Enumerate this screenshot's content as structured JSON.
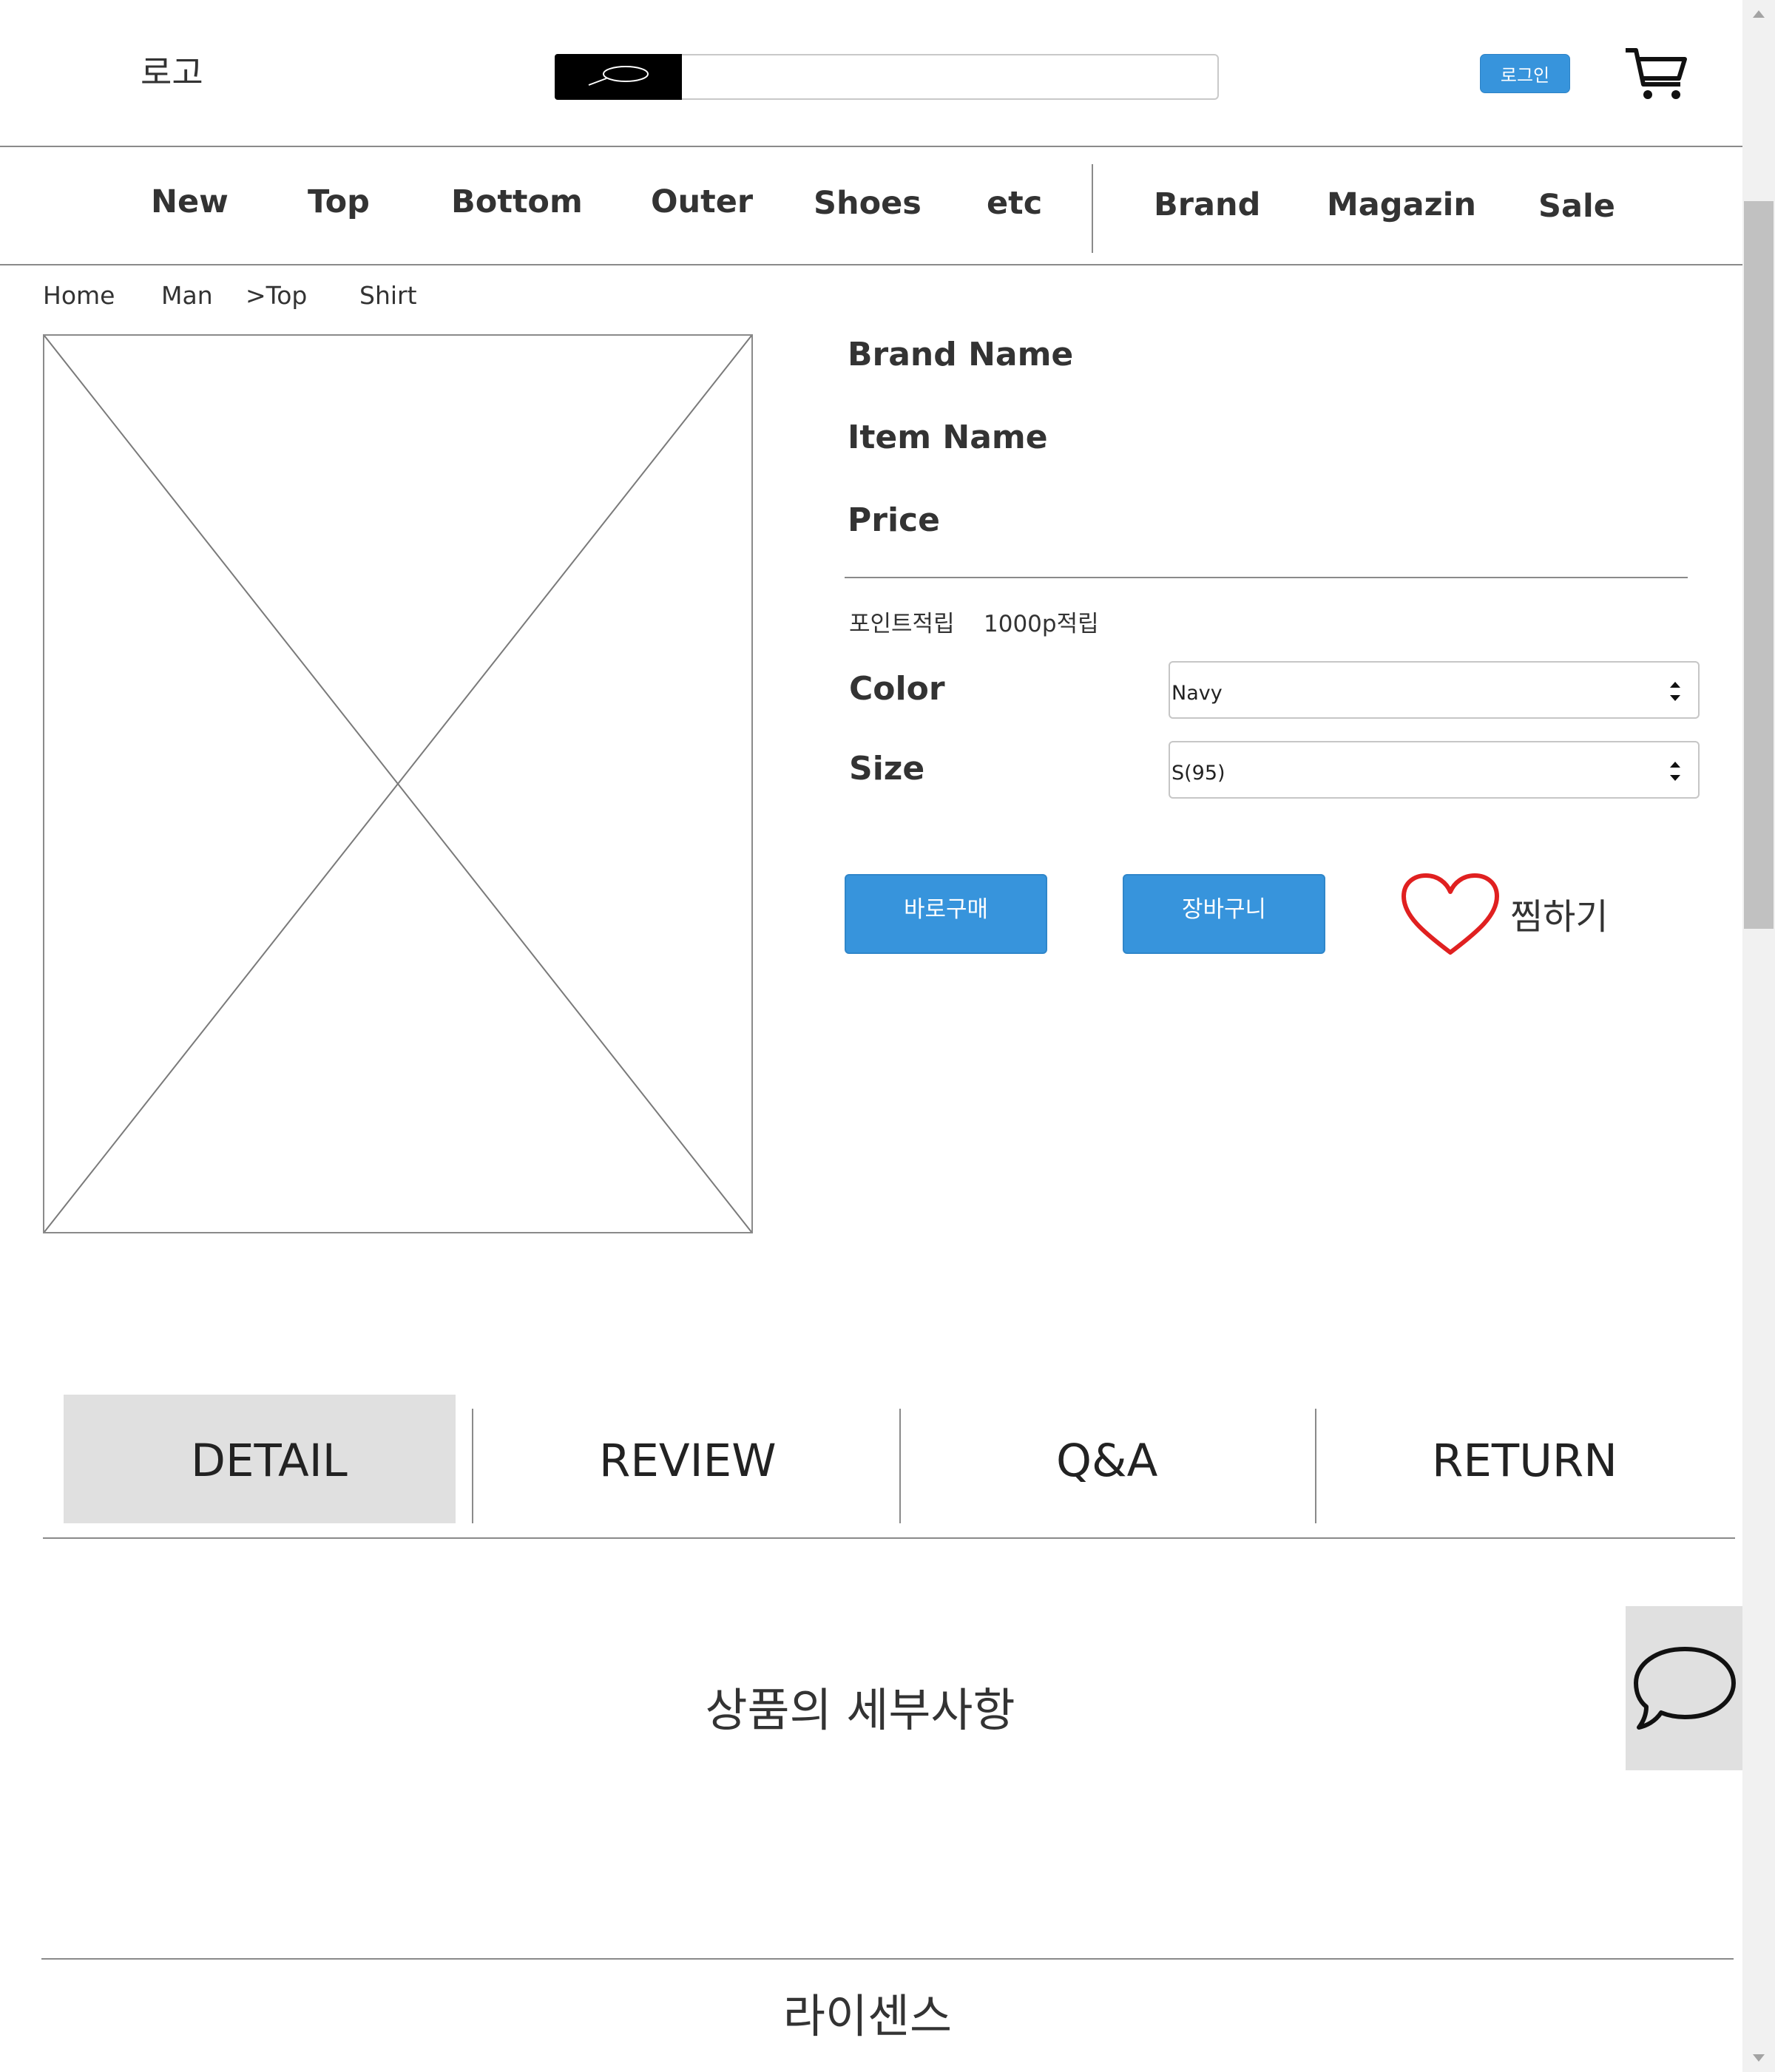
{
  "header": {
    "logo": "로고",
    "login_label": "로그인"
  },
  "nav": {
    "items": [
      "New",
      "Top",
      "Bottom",
      "Outer",
      "Shoes",
      "etc",
      "Brand",
      "Magazin",
      "Sale"
    ]
  },
  "breadcrumb": [
    "Home",
    "Man",
    ">Top",
    "Shirt"
  ],
  "product": {
    "brand_name": "Brand Name",
    "item_name": "Item Name",
    "price": "Price",
    "points_label": "포인트적립",
    "points_value": "1000p적립",
    "color_label": "Color",
    "color_value": "Navy",
    "size_label": "Size",
    "size_value": "S(95)",
    "buy_now_label": "바로구매",
    "cart_label": "장바구니",
    "wishlist_label": "찜하기"
  },
  "tabs": [
    "DETAIL",
    "REVIEW",
    "Q&A",
    "RETURN"
  ],
  "content": {
    "detail_heading": "상품의 세부사항",
    "license_heading": "라이센스"
  },
  "colors": {
    "accent": "#3794dc",
    "heart": "#e02020",
    "tab_active_bg": "#e0e0e0"
  }
}
